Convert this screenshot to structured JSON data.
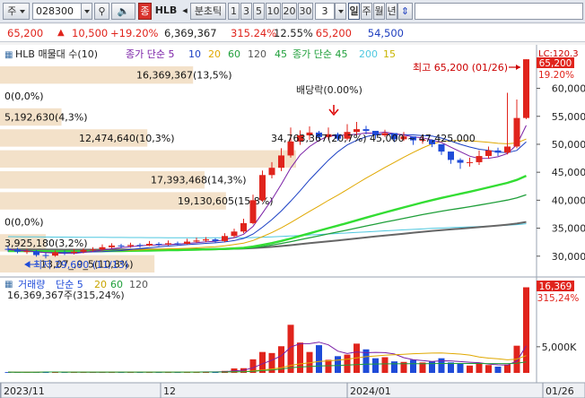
{
  "toolbar": {
    "market_label": "주",
    "code_value": "028300",
    "search_label": "⚲",
    "speaker_label": "🔈",
    "name_tag": "종",
    "stock_name": "HLB",
    "nav_prev_label": "◂",
    "timeframe_label": "분초틱",
    "minutes_options": [
      "1",
      "3",
      "5",
      "10",
      "20",
      "30"
    ],
    "minute_select_value": "3",
    "period_tabs": [
      "일",
      "주",
      "월",
      "년"
    ],
    "active_period": "일",
    "scroll_label": "⇕"
  },
  "infobar": {
    "current_price": "65,200",
    "up_arrow": "▲",
    "change": "10,500",
    "change_rate": "+19.20%",
    "volume": "6,369,367",
    "volume_ratio": "315.24%",
    "turnover": "12.55%",
    "high_price": "65,200",
    "low_price": "54,500"
  },
  "price_panel": {
    "legend_title": "HLB 매물대 수(10)",
    "ma_label_1": "종가 단순 5",
    "ma_periods_1": [
      "10",
      "20",
      "60",
      "120",
      "45"
    ],
    "ma_label_2": "종가 단순 45",
    "ma_periods_2": [
      "200",
      "15"
    ],
    "right_top_label": "LC:120.3",
    "last_price_box": "65,200",
    "sub_price_box": "19.20%",
    "high_annotation": "최고 65,200 (01/26)",
    "low_annotation": "최저 29,600 (11/13)",
    "dividend_annotation": "배당락(0.00%)",
    "zone_annotation": "34,763,367(20,7%) 45,000 ~ 47,425,000",
    "y_ticks": [
      "60,000",
      "55,000",
      "50,000",
      "45,000",
      "40,000",
      "35,000",
      "30,000"
    ],
    "volume_profile": [
      {
        "label": "16,369,367(13,5%)",
        "pct": 13.5
      },
      {
        "label": "0(0,0%)",
        "pct": 0
      },
      {
        "label": "5,192,630(4,3%)",
        "pct": 4.3
      },
      {
        "label": "12,474,640(10,3%)",
        "pct": 10.3
      },
      {
        "label": "",
        "pct": 20.7
      },
      {
        "label": "17,393,468(14,3%)",
        "pct": 14.3
      },
      {
        "label": "19,130,605(15,8%)",
        "pct": 15.8
      },
      {
        "label": "0(0,0%)",
        "pct": 0
      },
      {
        "label": "3,925,180(3,2%)",
        "pct": 3.2
      },
      {
        "label": "13,07_,9_5(10,8%)",
        "pct": 10.8
      }
    ]
  },
  "volume_panel": {
    "legend_title": "거래량",
    "ma_label": "단순 5",
    "ma_periods": [
      "20",
      "60",
      "120"
    ],
    "volume_summary": "16,369,367주(315,24%)",
    "last_volume_box": "16,369",
    "ratio_box": "315,24%",
    "y_tick": "5,000K"
  },
  "x_axis": {
    "labels": [
      "2023/11",
      "12",
      "2024/01",
      "01/26"
    ]
  },
  "colors": {
    "up": "#e0241c",
    "down": "#1f4bd8",
    "ma5": "#7a1fa6",
    "ma10": "#1a3fc4",
    "ma20": "#e0a800",
    "ma60": "#33dd33",
    "ma120": "#1f9f3a",
    "ma45": "#666666",
    "ma200": "#4fc8e0",
    "profile": "#f1dcc0"
  },
  "chart_data": {
    "type": "candlestick",
    "x": [
      "11/07",
      "11/08",
      "11/09",
      "11/10",
      "11/13",
      "11/14",
      "11/15",
      "11/16",
      "11/17",
      "11/20",
      "11/21",
      "11/22",
      "11/23",
      "11/24",
      "11/27",
      "11/28",
      "11/29",
      "11/30",
      "12/01",
      "12/04",
      "12/05",
      "12/06",
      "12/07",
      "12/08",
      "12/11",
      "12/12",
      "12/13",
      "12/14",
      "12/15",
      "12/18",
      "12/19",
      "12/20",
      "12/21",
      "12/22",
      "12/26",
      "12/27",
      "12/28",
      "01/02",
      "01/03",
      "01/04",
      "01/05",
      "01/08",
      "01/09",
      "01/10",
      "01/11",
      "01/12",
      "01/15",
      "01/16",
      "01/17",
      "01/18",
      "01/19",
      "01/22",
      "01/23",
      "01/24",
      "01/25",
      "01/26"
    ],
    "open": [
      31300,
      31200,
      30800,
      30900,
      30200,
      30100,
      30700,
      30600,
      30800,
      31100,
      31200,
      31600,
      31900,
      31800,
      32000,
      31900,
      32200,
      32100,
      32300,
      32200,
      32600,
      32800,
      33000,
      32700,
      33600,
      34400,
      35900,
      40000,
      44500,
      45800,
      48000,
      50500,
      51600,
      52100,
      51300,
      51800,
      51000,
      52200,
      52700,
      52400,
      51600,
      52000,
      50900,
      51400,
      50700,
      50800,
      50000,
      48700,
      47200,
      46700,
      46800,
      47900,
      48900,
      48500,
      49600,
      54700
    ],
    "close": [
      31200,
      30800,
      30900,
      30200,
      30100,
      30700,
      30600,
      30800,
      31100,
      31200,
      31600,
      31900,
      31800,
      32000,
      31900,
      32200,
      32100,
      32300,
      32200,
      32600,
      32800,
      33000,
      32700,
      33600,
      34400,
      35900,
      40000,
      44500,
      45800,
      48000,
      50500,
      51600,
      52100,
      51300,
      51800,
      51000,
      52200,
      52700,
      52400,
      51600,
      52000,
      50900,
      51400,
      50700,
      50800,
      50000,
      48700,
      47200,
      46700,
      46800,
      47900,
      48900,
      48500,
      49600,
      54700,
      65200
    ],
    "high": [
      31800,
      31500,
      31300,
      31100,
      30600,
      31000,
      31000,
      31300,
      31400,
      31600,
      32100,
      32300,
      32200,
      32400,
      32300,
      32700,
      32500,
      32800,
      32600,
      33100,
      33300,
      33400,
      33200,
      34100,
      34900,
      36700,
      41000,
      45300,
      46800,
      49300,
      53000,
      52500,
      53200,
      52400,
      53000,
      52100,
      53600,
      54000,
      53300,
      52400,
      52600,
      51800,
      52200,
      51300,
      51500,
      50900,
      49600,
      48000,
      47500,
      47600,
      48900,
      49600,
      49400,
      59200,
      58000,
      65200
    ],
    "low": [
      30800,
      30500,
      30400,
      29900,
      29600,
      29900,
      30200,
      30300,
      30500,
      30800,
      31000,
      31400,
      31400,
      31500,
      31500,
      31800,
      31800,
      31900,
      31900,
      32100,
      32400,
      32500,
      32400,
      32500,
      33300,
      34100,
      35700,
      39700,
      43900,
      45200,
      47600,
      49900,
      50800,
      50900,
      50900,
      50600,
      50700,
      51600,
      51800,
      51000,
      51300,
      50400,
      50600,
      49900,
      50100,
      49500,
      48100,
      46500,
      45600,
      46000,
      46300,
      47400,
      47900,
      48200,
      49300,
      54500
    ],
    "volume_k": [
      150,
      120,
      130,
      180,
      260,
      140,
      120,
      110,
      130,
      120,
      200,
      170,
      150,
      160,
      130,
      190,
      150,
      170,
      150,
      200,
      220,
      240,
      170,
      380,
      850,
      900,
      2600,
      4000,
      3800,
      5100,
      9200,
      5800,
      4000,
      5300,
      2500,
      3200,
      3500,
      5600,
      4500,
      2800,
      3000,
      2200,
      2100,
      2500,
      2000,
      2200,
      2800,
      2000,
      1800,
      1400,
      1800,
      1500,
      1200,
      1600,
      5200,
      16369
    ],
    "y_range": [
      29000,
      66500
    ],
    "high_point": {
      "label": "최고",
      "value": 65200,
      "date": "01/26"
    },
    "low_point": {
      "label": "최저",
      "value": 29600,
      "date": "11/13"
    }
  }
}
